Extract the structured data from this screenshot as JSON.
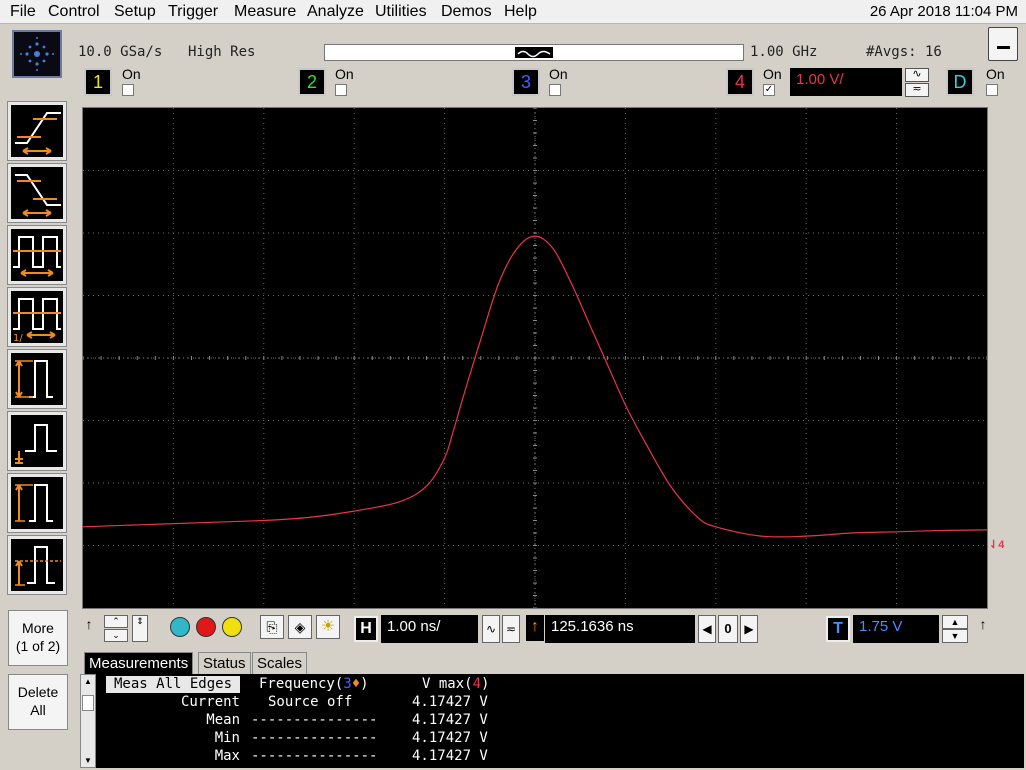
{
  "menu": {
    "items": [
      "File",
      "Control",
      "Setup",
      "Trigger",
      "Measure",
      "Analyze",
      "Utilities",
      "Demos",
      "Help"
    ],
    "datetime": "26 Apr 2018 11:04 PM"
  },
  "acquisition": {
    "sample_rate": "10.0 GSa/s",
    "mode": "High Res",
    "bandwidth": "1.00 GHz",
    "averages": "#Avgs: 16"
  },
  "channels": [
    {
      "label": "1",
      "state": "On",
      "checked": false,
      "color": "#f0e020"
    },
    {
      "label": "2",
      "state": "On",
      "checked": false,
      "color": "#30e030"
    },
    {
      "label": "3",
      "state": "On",
      "checked": false,
      "color": "#4060ff"
    },
    {
      "label": "4",
      "state": "On",
      "checked": true,
      "color": "#e8354a"
    },
    {
      "label": "D",
      "state": "On",
      "checked": false,
      "color": "#30d0e0"
    }
  ],
  "ch4_scale": "1.00 V/",
  "coupling": {
    "ac": "∿",
    "dc": "≂"
  },
  "side_buttons": {
    "more": "More",
    "more_page": "(1 of 2)",
    "delete": "Delete",
    "delete_all": "All"
  },
  "timebase": {
    "label": "H",
    "scale": "1.00 ns/",
    "delay": "125.1636 ns",
    "zero": "0"
  },
  "trigger": {
    "label": "T",
    "level": "1.75 V"
  },
  "tabs": [
    "Measurements",
    "Status",
    "Scales"
  ],
  "measurements": {
    "meas_all_edges": "Meas All Edges",
    "col1_header": "Frequency(",
    "col1_ch": "3",
    "col1_close": ")",
    "col2_header": "V max(",
    "col2_ch": "4",
    "col2_close": ")",
    "rows": [
      {
        "label": "Current",
        "freq": "Source off",
        "vmax": "4.17427 V"
      },
      {
        "label": "Mean",
        "freq": "---------------",
        "vmax": "4.17427 V"
      },
      {
        "label": "Min",
        "freq": "---------------",
        "vmax": "4.17427 V"
      },
      {
        "label": "Max",
        "freq": "---------------",
        "vmax": "4.17427 V"
      }
    ]
  },
  "chart_data": {
    "type": "line",
    "title": "",
    "xlabel": "",
    "ylabel": "",
    "grid": true,
    "x_divisions": 10,
    "y_divisions": 8,
    "x_unit": "div",
    "y_unit": "V",
    "x_range": [
      -5,
      5
    ],
    "ylim": [
      -4,
      4
    ],
    "series": [
      {
        "color": "#e8354a",
        "x": [
          -5.0,
          -4.0,
          -3.0,
          -2.5,
          -2.0,
          -1.5,
          -1.2,
          -1.0,
          -0.9,
          -0.8,
          -0.6,
          -0.4,
          -0.2,
          0.0,
          0.2,
          0.4,
          0.6,
          0.8,
          1.0,
          1.2,
          1.5,
          1.8,
          2.0,
          2.5,
          3.0,
          3.5,
          4.0,
          4.5,
          5.0
        ],
        "values": [
          -2.7,
          -2.65,
          -2.6,
          -2.55,
          -2.45,
          -2.3,
          -2.05,
          -1.6,
          -1.15,
          -0.65,
          0.3,
          1.2,
          1.75,
          1.95,
          1.75,
          1.2,
          0.55,
          -0.1,
          -0.75,
          -1.3,
          -2.05,
          -2.55,
          -2.7,
          -2.85,
          -2.85,
          -2.8,
          -2.78,
          -2.76,
          -2.75
        ]
      }
    ]
  }
}
